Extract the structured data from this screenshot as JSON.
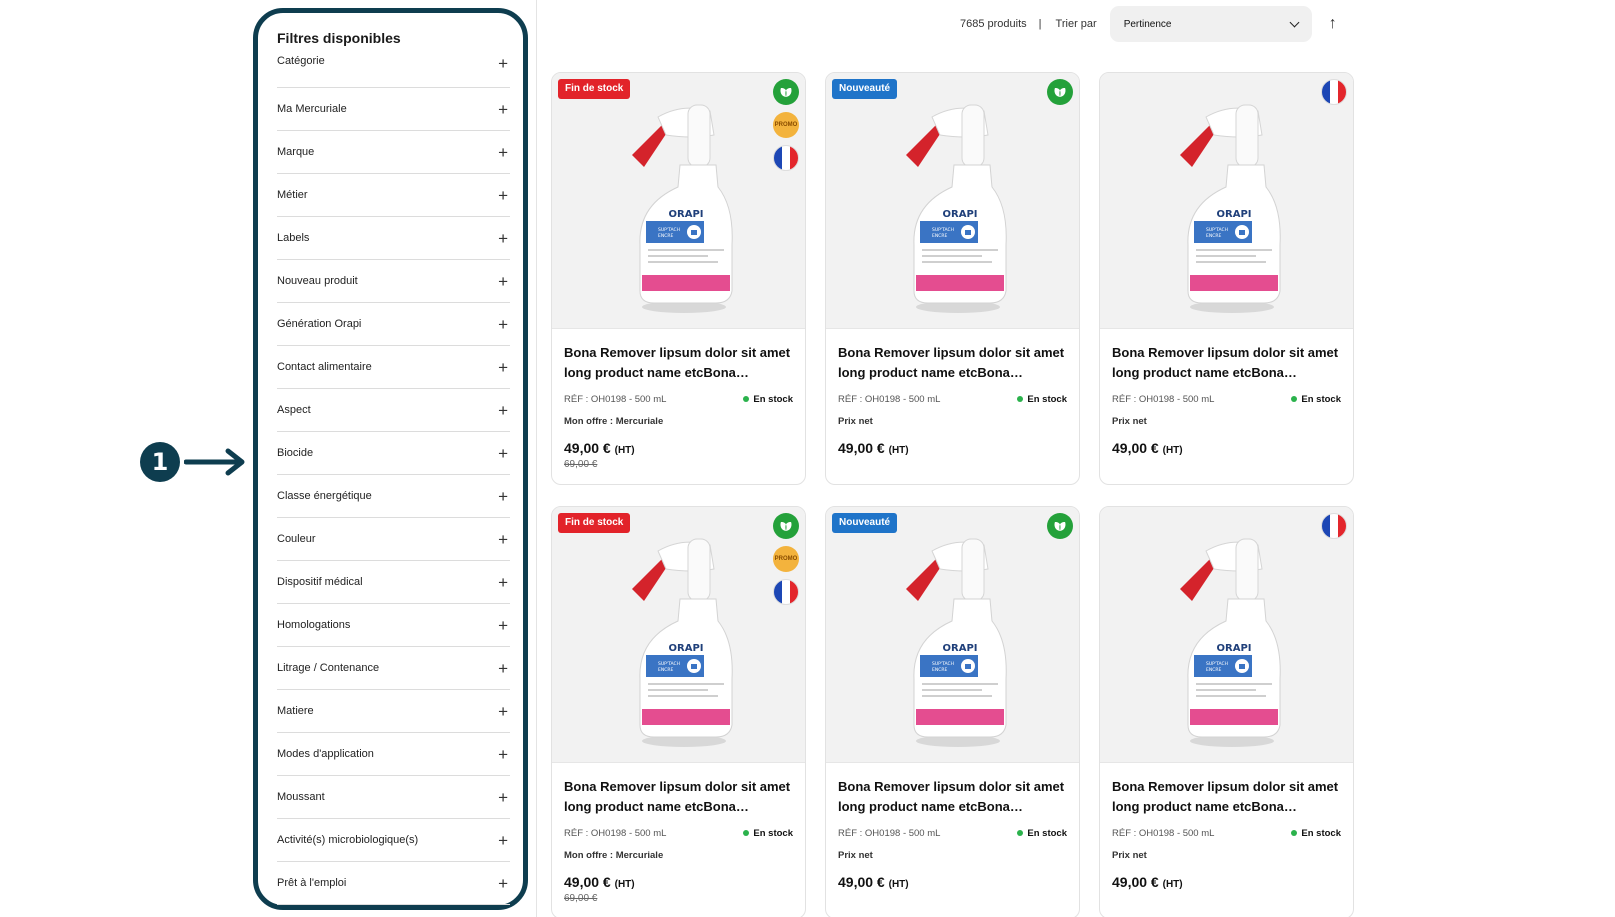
{
  "annotation": {
    "number": "1"
  },
  "filters": {
    "title": "Filtres disponibles",
    "items": [
      "Catégorie",
      "Ma Mercuriale",
      "Marque",
      "Métier",
      "Labels",
      "Nouveau produit",
      "Génération Orapi",
      "Contact alimentaire",
      "Aspect",
      "Biocide",
      "Classe énergétique",
      "Couleur",
      "Dispositif médical",
      "Homologations",
      "Litrage / Contenance",
      "Matiere",
      "Modes d'application",
      "Moussant",
      "Activité(s) microbiologique(s)",
      "Prêt à l'emploi"
    ],
    "expand_icon": "plus-icon"
  },
  "toolbar": {
    "count": "7685 produits",
    "separator": "|",
    "sort_label": "Trier par",
    "sort_value": "Pertinence",
    "sort_direction": "↑"
  },
  "products": [
    {
      "badge": "Fin de stock",
      "badge_color": "#e2232a",
      "icons": [
        "eco-icon",
        "promo-icon",
        "flag-fr-icon"
      ],
      "promo_text": "PROMO",
      "name": "Bona Remover lipsum dolor sit amet long product name etcBona Remover lipsum dolor sit amet",
      "ref": "RÉF : OH0198 - 500 mL",
      "stock": "En stock",
      "offer": "Mon offre : Mercuriale",
      "price": "49,00 €",
      "price_suffix": "(HT)",
      "old_price": "69,00 €"
    },
    {
      "badge": "Nouveauté",
      "badge_color": "#1f74c9",
      "icons": [
        "eco-icon"
      ],
      "name": "Bona Remover lipsum dolor sit amet long product name etcBona Remover lipsum dolor sit amet",
      "ref": "RÉF : OH0198 - 500 mL",
      "stock": "En stock",
      "offer": "Prix net",
      "price": "49,00 €",
      "price_suffix": "(HT)",
      "old_price": ""
    },
    {
      "badge": "",
      "icons": [
        "flag-fr-icon"
      ],
      "name": "Bona Remover lipsum dolor sit amet long product name etcBona Remover lipsum dolor sit amet",
      "ref": "RÉF : OH0198 - 500 mL",
      "stock": "En stock",
      "offer": "Prix net",
      "price": "49,00 €",
      "price_suffix": "(HT)",
      "old_price": ""
    },
    {
      "badge": "Fin de stock",
      "badge_color": "#e2232a",
      "icons": [
        "eco-icon",
        "promo-icon",
        "flag-fr-icon"
      ],
      "promo_text": "PROMO",
      "name": "Bona Remover lipsum dolor sit amet long product name etcBona Remover lipsum dolor sit amet",
      "ref": "RÉF : OH0198 - 500 mL",
      "stock": "En stock",
      "offer": "Mon offre : Mercuriale",
      "price": "49,00 €",
      "price_suffix": "(HT)",
      "old_price": "69,00 €"
    },
    {
      "badge": "Nouveauté",
      "badge_color": "#1f74c9",
      "icons": [
        "eco-icon"
      ],
      "name": "Bona Remover lipsum dolor sit amet long product name etcBona Remover lipsum dolor sit amet",
      "ref": "RÉF : OH0198 - 500 mL",
      "stock": "En stock",
      "offer": "Prix net",
      "price": "49,00 €",
      "price_suffix": "(HT)",
      "old_price": ""
    },
    {
      "badge": "",
      "icons": [
        "flag-fr-icon"
      ],
      "name": "Bona Remover lipsum dolor sit amet long product name etcBona Remover lipsum dolor sit amet",
      "ref": "RÉF : OH0198 - 500 mL",
      "stock": "En stock",
      "offer": "Prix net",
      "price": "49,00 €",
      "price_suffix": "(HT)",
      "old_price": ""
    }
  ],
  "product_image": {
    "brand": "ORAPI",
    "label_line": "SUP'TACH ENCRE"
  },
  "colors": {
    "accent_frame": "#0e3d4f",
    "in_stock": "#2bb24c"
  }
}
